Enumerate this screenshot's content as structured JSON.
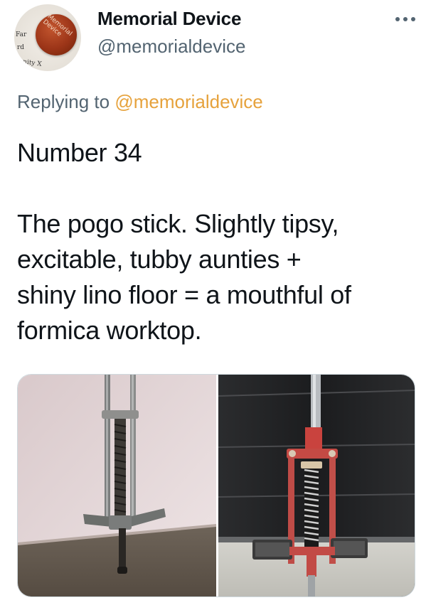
{
  "author": {
    "display_name": "Memorial Device",
    "handle": "@memorialdevice",
    "avatar": {
      "badge_text": "Memorial Device",
      "background_fragments": [
        "Far",
        "rd",
        "nity X"
      ]
    }
  },
  "reply": {
    "prefix": "Replying to",
    "mention": "@memorialdevice"
  },
  "tweet": {
    "headline": "Number 34",
    "body_lines": [
      "The pogo stick. Slightly tipsy,",
      "excitable, tubby aunties +",
      "shiny lino floor = a mouthful of",
      "formica worktop."
    ]
  },
  "media": {
    "photos": [
      {
        "subject": "pogo-stick-indoor"
      },
      {
        "subject": "pogo-stick-red-outdoor"
      }
    ]
  },
  "icons": {
    "more": "more-horizontal-icon"
  },
  "colors": {
    "text_primary": "#0f1419",
    "text_secondary": "#536471",
    "mention": "#e6a23c",
    "badge": "#9c3518"
  }
}
